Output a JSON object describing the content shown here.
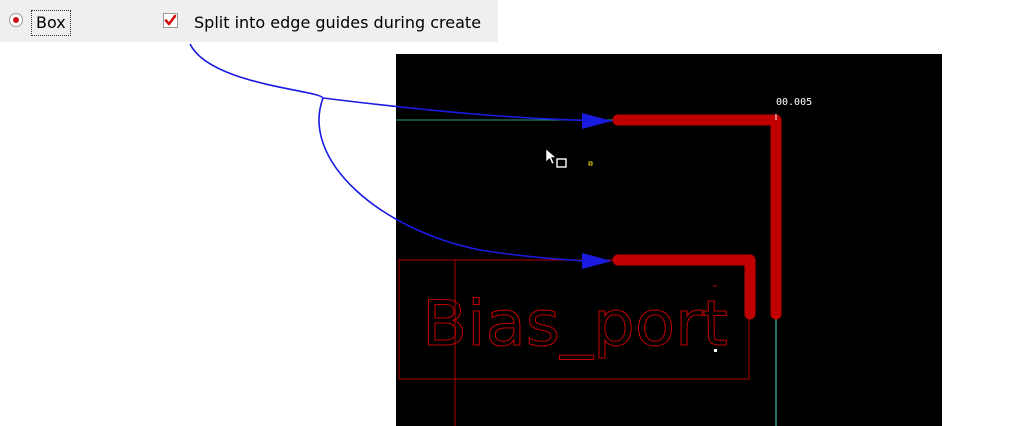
{
  "options": {
    "shape_radio_label": "Box",
    "shape_radio_selected": true,
    "split_checkbox_label": "Split into edge guides during create",
    "split_checkbox_checked": true
  },
  "layout_view": {
    "dimension_text": "00.005",
    "port_label": "Bias_port"
  },
  "icons": [
    "radio-selected-icon",
    "checkmark-icon",
    "cursor-arrow-icon",
    "arrow-head-icon"
  ],
  "colors": {
    "canvas_background": "#000000",
    "edge_guide": "#c00000",
    "label_outline": "#b00000",
    "axis_line": "#2a9a8a",
    "annotation_arrow": "#1a1ae0",
    "check_mark": "#d01010"
  }
}
